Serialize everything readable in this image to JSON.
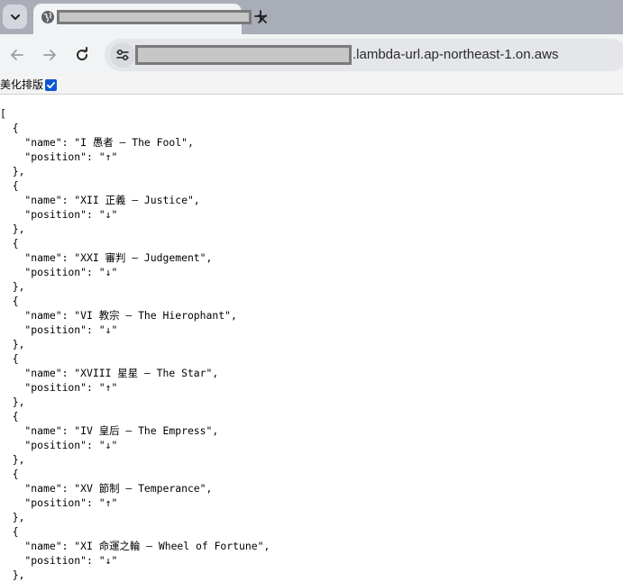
{
  "browser": {
    "address_bar": {
      "url_suffix": ".lambda-url.ap-northeast-1.on.aws"
    }
  },
  "pretty_print": {
    "label": "美化排版",
    "checked": true
  },
  "json_lines": [
    "[",
    "  {",
    "    \"name\": \"I 愚者 — The Fool\",",
    "    \"position\": \"↑\"",
    "  },",
    "  {",
    "    \"name\": \"XII 正義 — Justice\",",
    "    \"position\": \"↓\"",
    "  },",
    "  {",
    "    \"name\": \"XXI 審判 — Judgement\",",
    "    \"position\": \"↓\"",
    "  },",
    "  {",
    "    \"name\": \"VI 教宗 — The Hierophant\",",
    "    \"position\": \"↓\"",
    "  },",
    "  {",
    "    \"name\": \"XVIII 星星 — The Star\",",
    "    \"position\": \"↑\"",
    "  },",
    "  {",
    "    \"name\": \"IV 皇后 — The Empress\",",
    "    \"position\": \"↓\"",
    "  },",
    "  {",
    "    \"name\": \"XV 節制 — Temperance\",",
    "    \"position\": \"↑\"",
    "  },",
    "  {",
    "    \"name\": \"XI 命運之輪 — Wheel of Fortune\",",
    "    \"position\": \"↓\"",
    "  },"
  ]
}
